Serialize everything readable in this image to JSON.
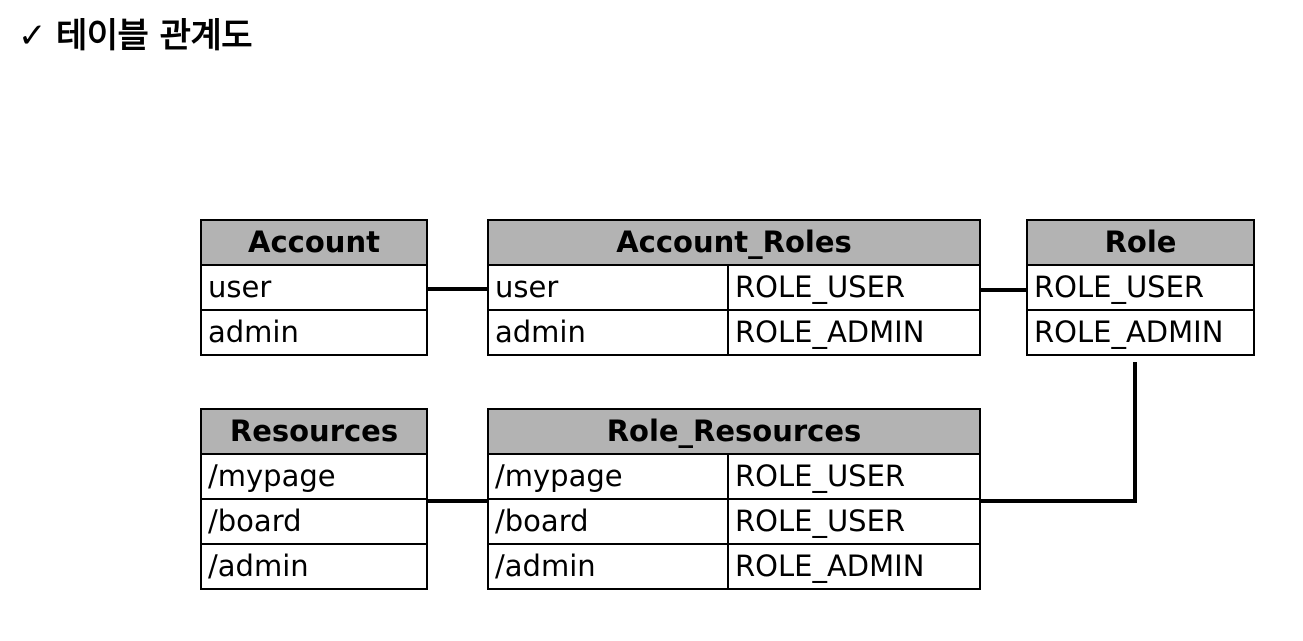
{
  "title": {
    "check_mark": "✓",
    "text": "테이블 관계도"
  },
  "tables": {
    "account": {
      "name": "Account",
      "rows": [
        [
          "user"
        ],
        [
          "admin"
        ]
      ]
    },
    "account_roles": {
      "name": "Account_Roles",
      "rows": [
        [
          "user",
          "ROLE_USER"
        ],
        [
          "admin",
          "ROLE_ADMIN"
        ]
      ]
    },
    "role": {
      "name": "Role",
      "rows": [
        [
          "ROLE_USER"
        ],
        [
          "ROLE_ADMIN"
        ]
      ]
    },
    "resources": {
      "name": "Resources",
      "rows": [
        [
          "/mypage"
        ],
        [
          "/board"
        ],
        [
          "/admin"
        ]
      ]
    },
    "role_resources": {
      "name": "Role_Resources",
      "rows": [
        [
          "/mypage",
          "ROLE_USER"
        ],
        [
          "/board",
          "ROLE_USER"
        ],
        [
          "/admin",
          "ROLE_ADMIN"
        ]
      ]
    }
  },
  "colors": {
    "header_background": "#b3b3b3",
    "border": "#000000",
    "connector": "#000000"
  }
}
